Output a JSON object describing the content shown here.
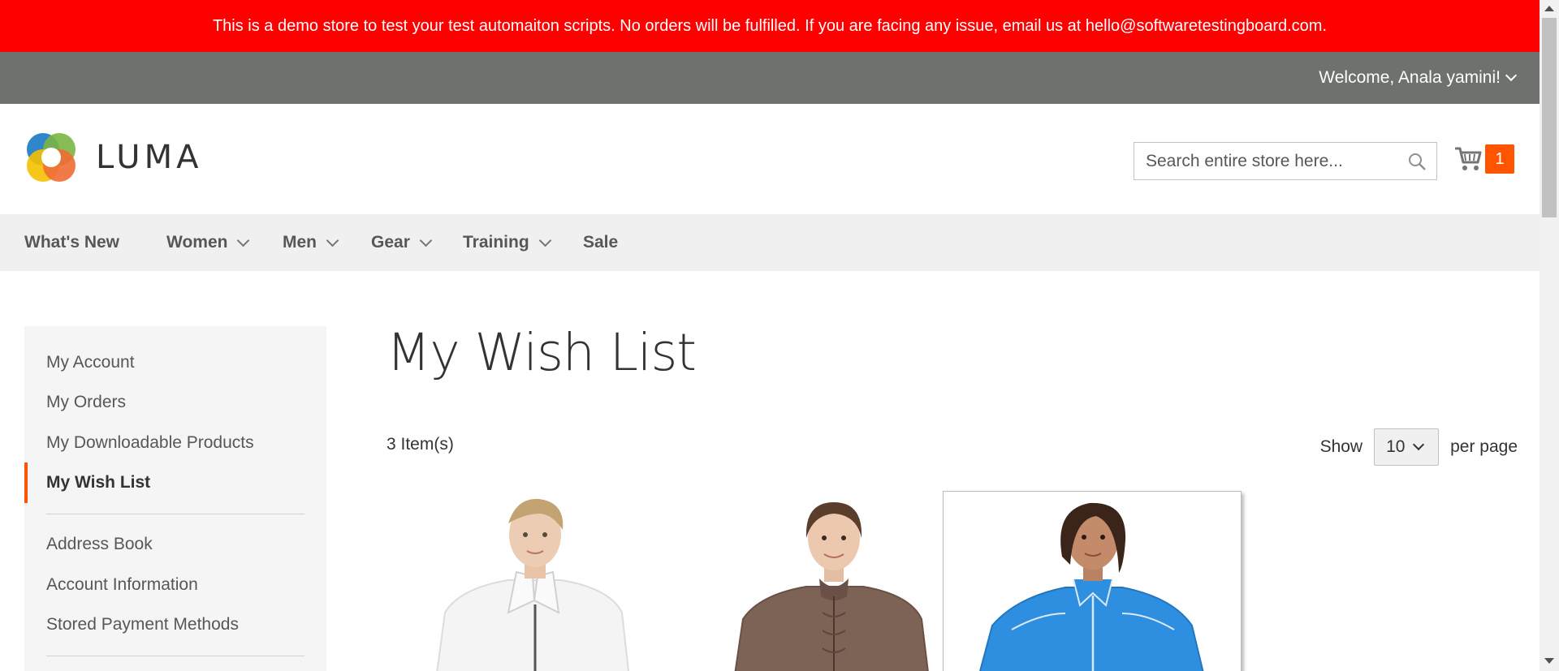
{
  "banner": {
    "text": "This is a demo store to test your test automaiton scripts. No orders will be fulfilled. If you are facing any issue, email us at hello@softwaretestingboard.com."
  },
  "header_panel": {
    "welcome": "Welcome, Anala yamini!"
  },
  "logo": {
    "text": "LUMA"
  },
  "search": {
    "placeholder": "Search entire store here..."
  },
  "cart": {
    "count": "1"
  },
  "nav": {
    "items": [
      {
        "label": "What's New"
      },
      {
        "label": "Women"
      },
      {
        "label": "Men"
      },
      {
        "label": "Gear"
      },
      {
        "label": "Training"
      },
      {
        "label": "Sale"
      }
    ]
  },
  "sidebar": {
    "items": [
      {
        "label": "My Account"
      },
      {
        "label": "My Orders"
      },
      {
        "label": "My Downloadable Products"
      },
      {
        "label": "My Wish List"
      },
      {
        "label": "Address Book"
      },
      {
        "label": "Account Information"
      },
      {
        "label": "Stored Payment Methods"
      }
    ],
    "active": "My Wish List"
  },
  "main": {
    "title": "My Wish List",
    "item_count": "3 Item(s)",
    "limiter": {
      "show_label": "Show",
      "value": "10",
      "per_page_label": "per page"
    }
  },
  "products": [
    {
      "image": "white jacket"
    },
    {
      "image": "brown jacket"
    },
    {
      "image": "blue jacket"
    }
  ],
  "colors": {
    "banner": "#ff0000",
    "panel": "#6e716e",
    "accent": "#ff5501",
    "nav_bg": "#f0f0f0",
    "sidebar_bg": "#f5f5f5"
  }
}
